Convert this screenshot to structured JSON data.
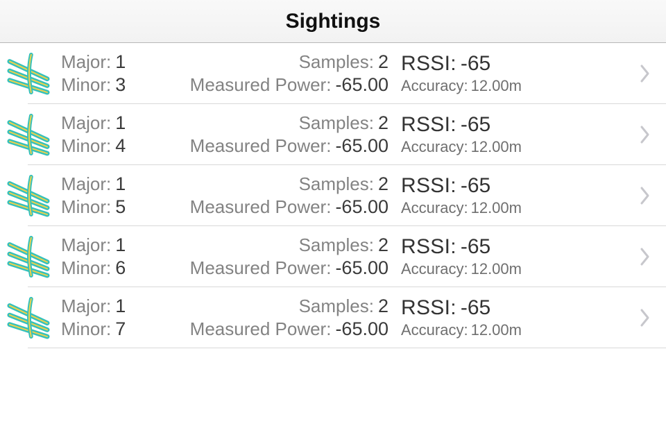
{
  "header": {
    "title": "Sightings"
  },
  "labels": {
    "major": "Major:",
    "minor": "Minor:",
    "samples": "Samples:",
    "measured_power": "Measured Power:",
    "rssi": "RSSI:",
    "accuracy": "Accuracy:"
  },
  "colors": {
    "icon_teal": "#35c0bb",
    "icon_yellow": "#f2d24a",
    "muted": "#838383",
    "text": "#333333",
    "divider": "#d8d8d8",
    "chevron": "#c7c7cc"
  },
  "rows": [
    {
      "major": "1",
      "minor": "3",
      "samples": "2",
      "measured_power": "-65.00",
      "rssi": "-65",
      "accuracy": "12.00m"
    },
    {
      "major": "1",
      "minor": "4",
      "samples": "2",
      "measured_power": "-65.00",
      "rssi": "-65",
      "accuracy": "12.00m"
    },
    {
      "major": "1",
      "minor": "5",
      "samples": "2",
      "measured_power": "-65.00",
      "rssi": "-65",
      "accuracy": "12.00m"
    },
    {
      "major": "1",
      "minor": "6",
      "samples": "2",
      "measured_power": "-65.00",
      "rssi": "-65",
      "accuracy": "12.00m"
    },
    {
      "major": "1",
      "minor": "7",
      "samples": "2",
      "measured_power": "-65.00",
      "rssi": "-65",
      "accuracy": "12.00m"
    }
  ]
}
